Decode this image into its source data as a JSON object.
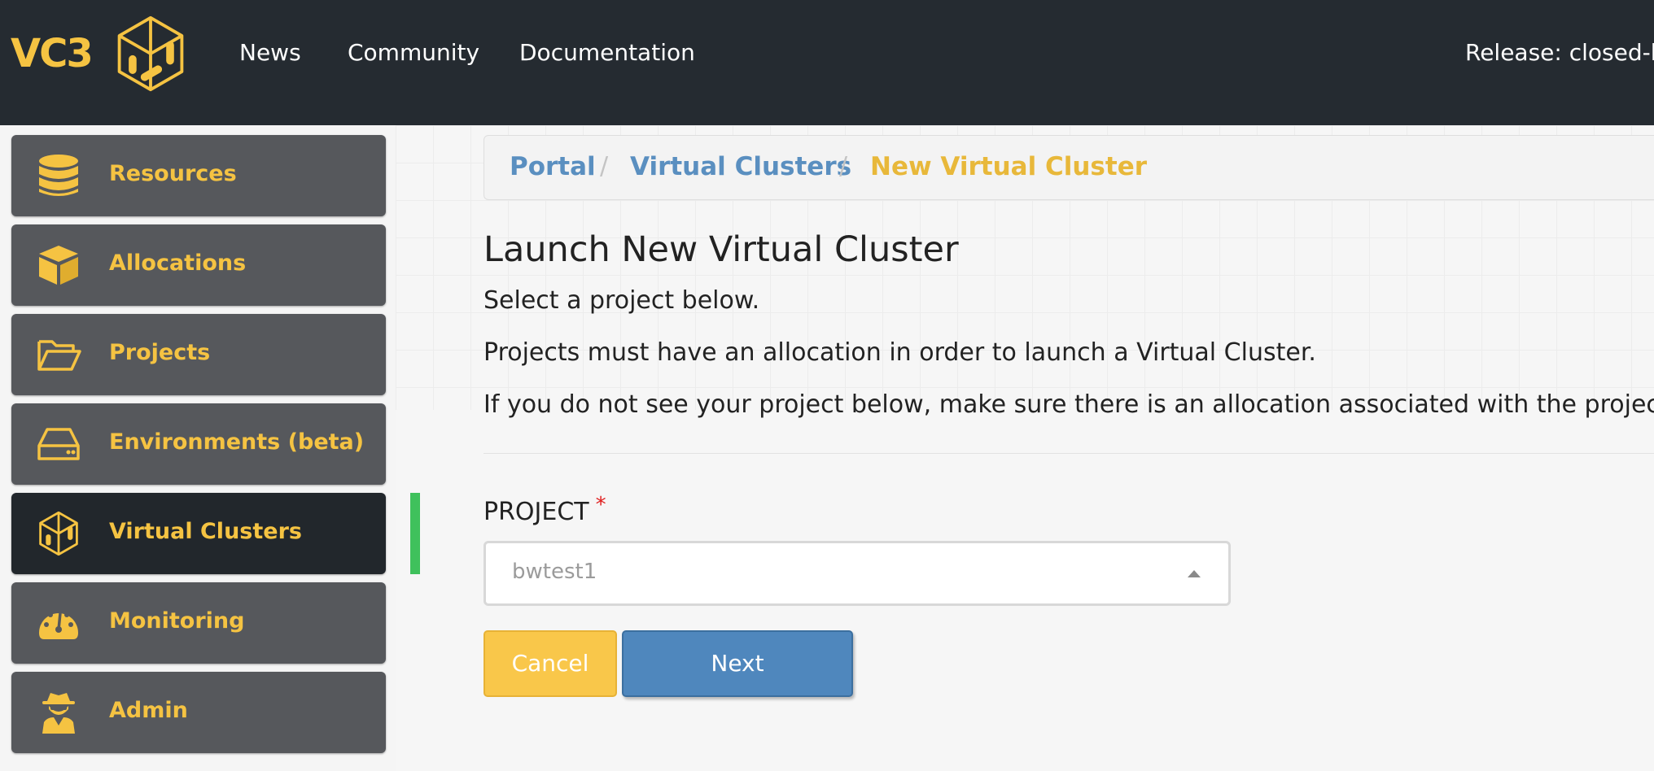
{
  "brand": {
    "text": "VC3"
  },
  "nav": {
    "links": [
      "News",
      "Community",
      "Documentation"
    ],
    "release": "Release: closed-b"
  },
  "sidebar": {
    "items": [
      {
        "label": "Resources",
        "icon": "database-icon"
      },
      {
        "label": "Allocations",
        "icon": "cube-icon"
      },
      {
        "label": "Projects",
        "icon": "folder-open-icon"
      },
      {
        "label": "Environments (beta)",
        "icon": "hard-drive-icon"
      },
      {
        "label": "Virtual Clusters",
        "icon": "vc3-logo-icon",
        "active": true
      },
      {
        "label": "Monitoring",
        "icon": "tachometer-icon"
      },
      {
        "label": "Admin",
        "icon": "user-secret-icon"
      }
    ]
  },
  "breadcrumb": {
    "items": [
      "Portal",
      "Virtual Clusters",
      "New Virtual Cluster"
    ],
    "separator": "/"
  },
  "main": {
    "title": "Launch New Virtual Cluster",
    "paragraphs": [
      "Select a project below.",
      "Projects must have an allocation in order to launch a Virtual Cluster.",
      "If you do not see your project below, make sure there is an allocation associated with the project."
    ],
    "form": {
      "project_label": "PROJECT",
      "required_mark": "*",
      "project_value": "bwtest1"
    },
    "buttons": {
      "cancel": "Cancel",
      "next": "Next"
    }
  },
  "colors": {
    "accent": "#f5c342",
    "navbar": "#252b31",
    "link": "#5a8fc0",
    "active_indicator": "#3fc15c",
    "next_button": "#4f87bd",
    "cancel_button": "#f9c74a"
  }
}
